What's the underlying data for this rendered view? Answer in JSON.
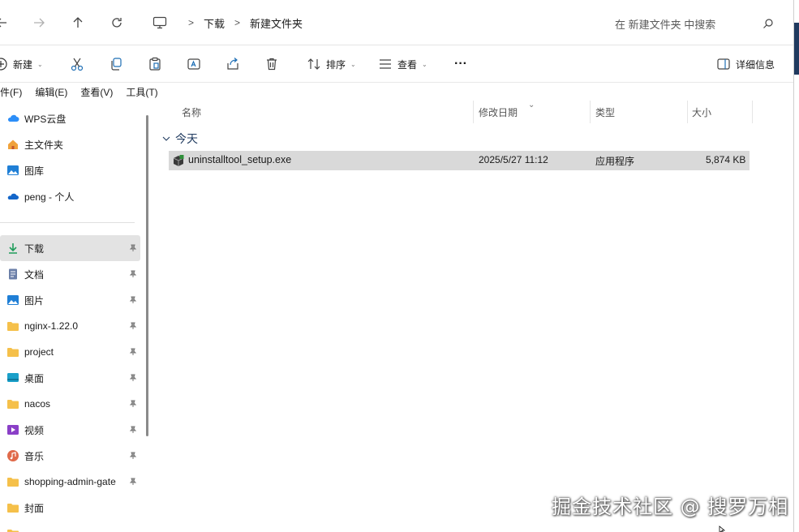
{
  "nav": {
    "breadcrumb": [
      "下载",
      "新建文件夹"
    ],
    "search_placeholder": "在 新建文件夹 中搜索"
  },
  "toolbar": {
    "new_label": "新建",
    "sort_label": "排序",
    "view_label": "查看",
    "more_label": "···",
    "details_label": "详细信息"
  },
  "menu": [
    "件(F)",
    "编辑(E)",
    "查看(V)",
    "工具(T)"
  ],
  "sidebar": {
    "items": [
      {
        "label": "WPS云盘",
        "icon": "cloud-icon"
      },
      {
        "label": "主文件夹",
        "icon": "home-icon"
      },
      {
        "label": "图库",
        "icon": "gallery-icon"
      },
      {
        "label": "peng - 个人",
        "icon": "onedrive-icon"
      }
    ],
    "pinned": [
      {
        "label": "下载",
        "icon": "download-icon",
        "selected": true
      },
      {
        "label": "文档",
        "icon": "document-icon"
      },
      {
        "label": "图片",
        "icon": "picture-icon"
      },
      {
        "label": "nginx-1.22.0",
        "icon": "folder-icon"
      },
      {
        "label": "project",
        "icon": "folder-icon"
      },
      {
        "label": "桌面",
        "icon": "desktop-icon"
      },
      {
        "label": "nacos",
        "icon": "folder-icon"
      },
      {
        "label": "视频",
        "icon": "video-icon"
      },
      {
        "label": "音乐",
        "icon": "music-icon"
      },
      {
        "label": "shopping-admin-gate",
        "icon": "folder-icon"
      },
      {
        "label": "封面",
        "icon": "folder-icon"
      }
    ]
  },
  "columns": {
    "name": "名称",
    "date": "修改日期",
    "type": "类型",
    "size": "大小"
  },
  "group": {
    "title": "今天"
  },
  "files": [
    {
      "name": "uninstalltool_setup.exe",
      "date": "2025/5/27 11:12",
      "type": "应用程序",
      "size": "5,874 KB"
    }
  ],
  "watermark": "掘金技术社区 @ 搜罗万相",
  "colors": {
    "selected_row": "#d9d9d9",
    "accent": "#1f3a5f",
    "folder": "#f5c04a"
  }
}
